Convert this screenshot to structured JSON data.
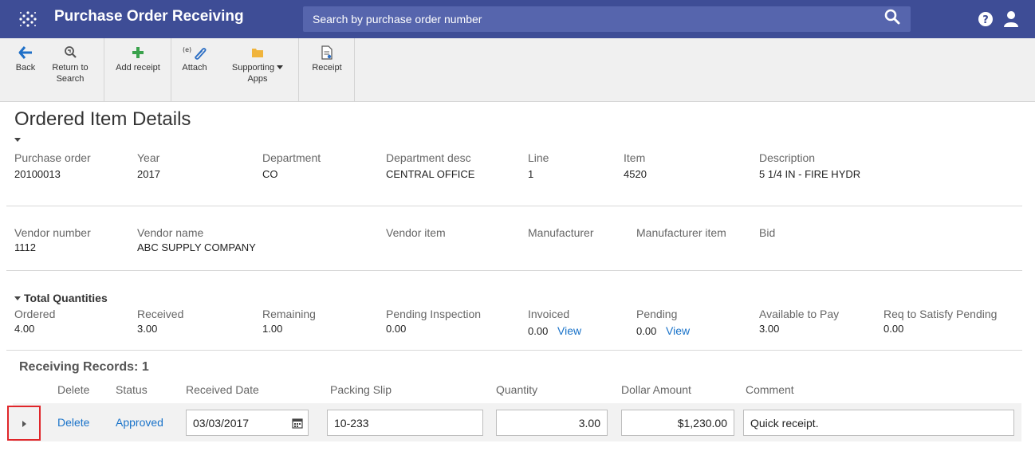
{
  "app": {
    "title": "Purchase Order Receiving",
    "search_placeholder": "Search by purchase order number"
  },
  "toolbar": {
    "back": "Back",
    "return_to_search": [
      "Return to",
      "Search"
    ],
    "add_receipt": "Add receipt",
    "attach_prefix": "(e)",
    "attach": "Attach",
    "supporting_apps": [
      "Supporting",
      "Apps"
    ],
    "receipt": "Receipt"
  },
  "page": {
    "title": "Ordered Item Details"
  },
  "details": {
    "purchase_order": {
      "label": "Purchase order",
      "value": "20100013"
    },
    "year": {
      "label": "Year",
      "value": "2017"
    },
    "department": {
      "label": "Department",
      "value": "CO"
    },
    "department_desc": {
      "label": "Department desc",
      "value": "CENTRAL OFFICE"
    },
    "line": {
      "label": "Line",
      "value": "1"
    },
    "item": {
      "label": "Item",
      "value": "4520"
    },
    "description": {
      "label": "Description",
      "value": "5 1/4 IN - FIRE HYDR"
    }
  },
  "vendor": {
    "vendor_number": {
      "label": "Vendor number",
      "value": "1112"
    },
    "vendor_name": {
      "label": "Vendor name",
      "value": "ABC SUPPLY COMPANY"
    },
    "vendor_item": {
      "label": "Vendor item",
      "value": ""
    },
    "manufacturer": {
      "label": "Manufacturer",
      "value": ""
    },
    "manufacturer_item": {
      "label": "Manufacturer item",
      "value": ""
    },
    "bid": {
      "label": "Bid",
      "value": ""
    }
  },
  "quantities": {
    "section_title": "Total Quantities",
    "ordered": {
      "label": "Ordered",
      "value": "4.00"
    },
    "received": {
      "label": "Received",
      "value": "3.00"
    },
    "remaining": {
      "label": "Remaining",
      "value": "1.00"
    },
    "pending_inspection": {
      "label": "Pending Inspection",
      "value": "0.00"
    },
    "invoiced": {
      "label": "Invoiced",
      "value": "0.00",
      "link": "View"
    },
    "pending": {
      "label": "Pending",
      "value": "0.00",
      "link": "View"
    },
    "available_to_pay": {
      "label": "Available to Pay",
      "value": "3.00"
    },
    "req_to_satisfy_pending": {
      "label": "Req to Satisfy Pending",
      "value": "0.00"
    }
  },
  "records": {
    "title": "Receiving Records: 1",
    "columns": [
      "Delete",
      "Status",
      "Received Date",
      "Packing Slip",
      "Quantity",
      "Dollar Amount",
      "Comment"
    ],
    "rows": [
      {
        "delete": "Delete",
        "status": "Approved",
        "received_date": "03/03/2017",
        "packing_slip": "10-233",
        "quantity": "3.00",
        "dollar_amount": "$1,230.00",
        "comment": "Quick receipt."
      }
    ]
  },
  "colors": {
    "header_bg": "#3e4d96",
    "search_bg": "#5665ad",
    "link": "#1a73c9",
    "add_green": "#3aa24c",
    "folder_yellow": "#f0b43c",
    "back_blue": "#1f6fc7",
    "highlight_red": "#e0262a"
  },
  "icons": {
    "logo": "dotted-diamond-logo",
    "search": "search-icon",
    "help": "help-icon",
    "user": "user-icon",
    "back": "arrow-left-icon",
    "return_to_search": "search-return-icon",
    "add_receipt": "plus-icon",
    "attach": "paperclip-icon",
    "supporting_apps": "folder-icon",
    "receipt": "document-icon",
    "calendar": "calendar-icon",
    "expander": "triangle-right-icon"
  }
}
